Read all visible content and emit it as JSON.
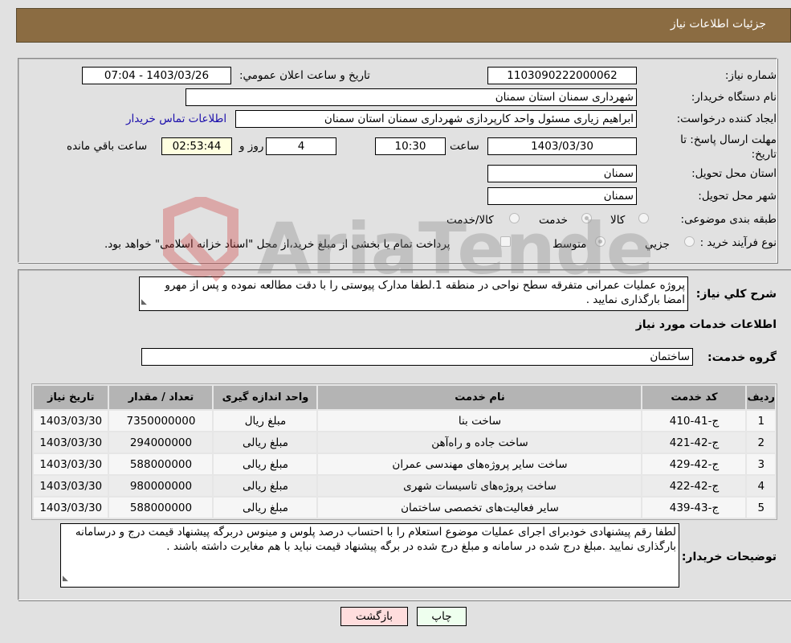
{
  "header": {
    "title": "جزئیات اطلاعات نیاز"
  },
  "form": {
    "need_number_label": "شماره نیاز:",
    "need_number": "1103090222000062",
    "announce_label": "تاريخ و ساعت اعلان عمومي:",
    "announce_value": "1403/03/26 - 07:04",
    "buyer_org_label": "نام دستگاه خريدار:",
    "buyer_org": "شهرداری سمنان استان سمنان",
    "requester_label": "ايجاد کننده درخواست:",
    "requester": "ابراهیم زیاری مسئول واحد کارپردازی شهرداری سمنان استان سمنان",
    "contact_link": "اطلاعات تماس خريدار",
    "deadline_label": "مهلت ارسال پاسخ: تا تاريخ:",
    "deadline_date": "1403/03/30",
    "time_label": "ساعت",
    "deadline_time": "10:30",
    "days_value": "4",
    "days_label": "روز و",
    "remaining_time": "02:53:44",
    "remaining_label": "ساعت باقي مانده",
    "province_label": "استان محل تحويل:",
    "province": "سمنان",
    "city_label": "شهر محل تحويل:",
    "city": "سمنان",
    "category_label": "طبقه بندی موضوعی:",
    "category_options": [
      {
        "label": "کالا",
        "selected": false
      },
      {
        "label": "خدمت",
        "selected": true
      },
      {
        "label": "کالا/خدمت",
        "selected": false
      }
    ],
    "purchase_type_label": "نوع فرآيند خريد :",
    "purchase_type_options": [
      {
        "label": "جزيي",
        "selected": false
      },
      {
        "label": "متوسط",
        "selected": true
      }
    ],
    "treasury_note": "پرداخت تمام يا بخشی از مبلغ خريد،از محل \"اسناد خزانه اسلامی\" خواهد بود."
  },
  "details": {
    "description_label": "شرح کلي نياز:",
    "description": "پروژه عملیات عمرانی متفرقه سطح نواحی در منطقه 1.لطفا مدارک پیوستی را با دقت مطالعه نموده و پس از مهرو امضا بارگذاری نمایید .",
    "services_heading": "اطلاعات خدمات مورد نياز",
    "service_group_label": "گروه خدمت:",
    "service_group": "ساختمان",
    "table": {
      "headers": [
        "رديف",
        "کد خدمت",
        "نام خدمت",
        "واحد اندازه گيری",
        "تعداد / مقدار",
        "تاريخ نياز"
      ],
      "rows": [
        [
          "1",
          "ج-41-410",
          "ساخت بنا",
          "مبلغ ریال",
          "7350000000",
          "1403/03/30"
        ],
        [
          "2",
          "ج-42-421",
          "ساخت جاده و راه‌آهن",
          "مبلغ ریالی",
          "294000000",
          "1403/03/30"
        ],
        [
          "3",
          "ج-42-429",
          "ساخت سایر پروژه‌های مهندسی عمران",
          "مبلغ ریالی",
          "588000000",
          "1403/03/30"
        ],
        [
          "4",
          "ج-42-422",
          "ساخت پروژه‌های تاسیسات شهری",
          "مبلغ ریالی",
          "980000000",
          "1403/03/30"
        ],
        [
          "5",
          "ج-43-439",
          "سایر فعالیت‌های تخصصی ساختمان",
          "مبلغ ریالی",
          "588000000",
          "1403/03/30"
        ]
      ]
    },
    "buyer_notes_label": "توضيحات خريدار:",
    "buyer_notes": "لطفا رقم پیشنهادی خودبرای اجرای عملیات موضوع استعلام را با احتساب درصد پلوس و مینوس دربرگه پیشنهاد قیمت درج و درسامانه بارگذاری نمایید .مبلغ درج شده در سامانه و مبلغ درج شده در برگه پیشنهاد قیمت نباید با هم مغایرت داشته باشند ."
  },
  "buttons": {
    "print": "چاپ",
    "back": "بازگشت"
  },
  "watermark": {
    "text": "AriaTender.neT"
  },
  "colors": {
    "title_bar": "#8b6c42",
    "print_bg": "#eeffee",
    "back_bg": "#ffdddd",
    "link": "#1a0dab",
    "remaining_bg": "#ffffe0"
  }
}
